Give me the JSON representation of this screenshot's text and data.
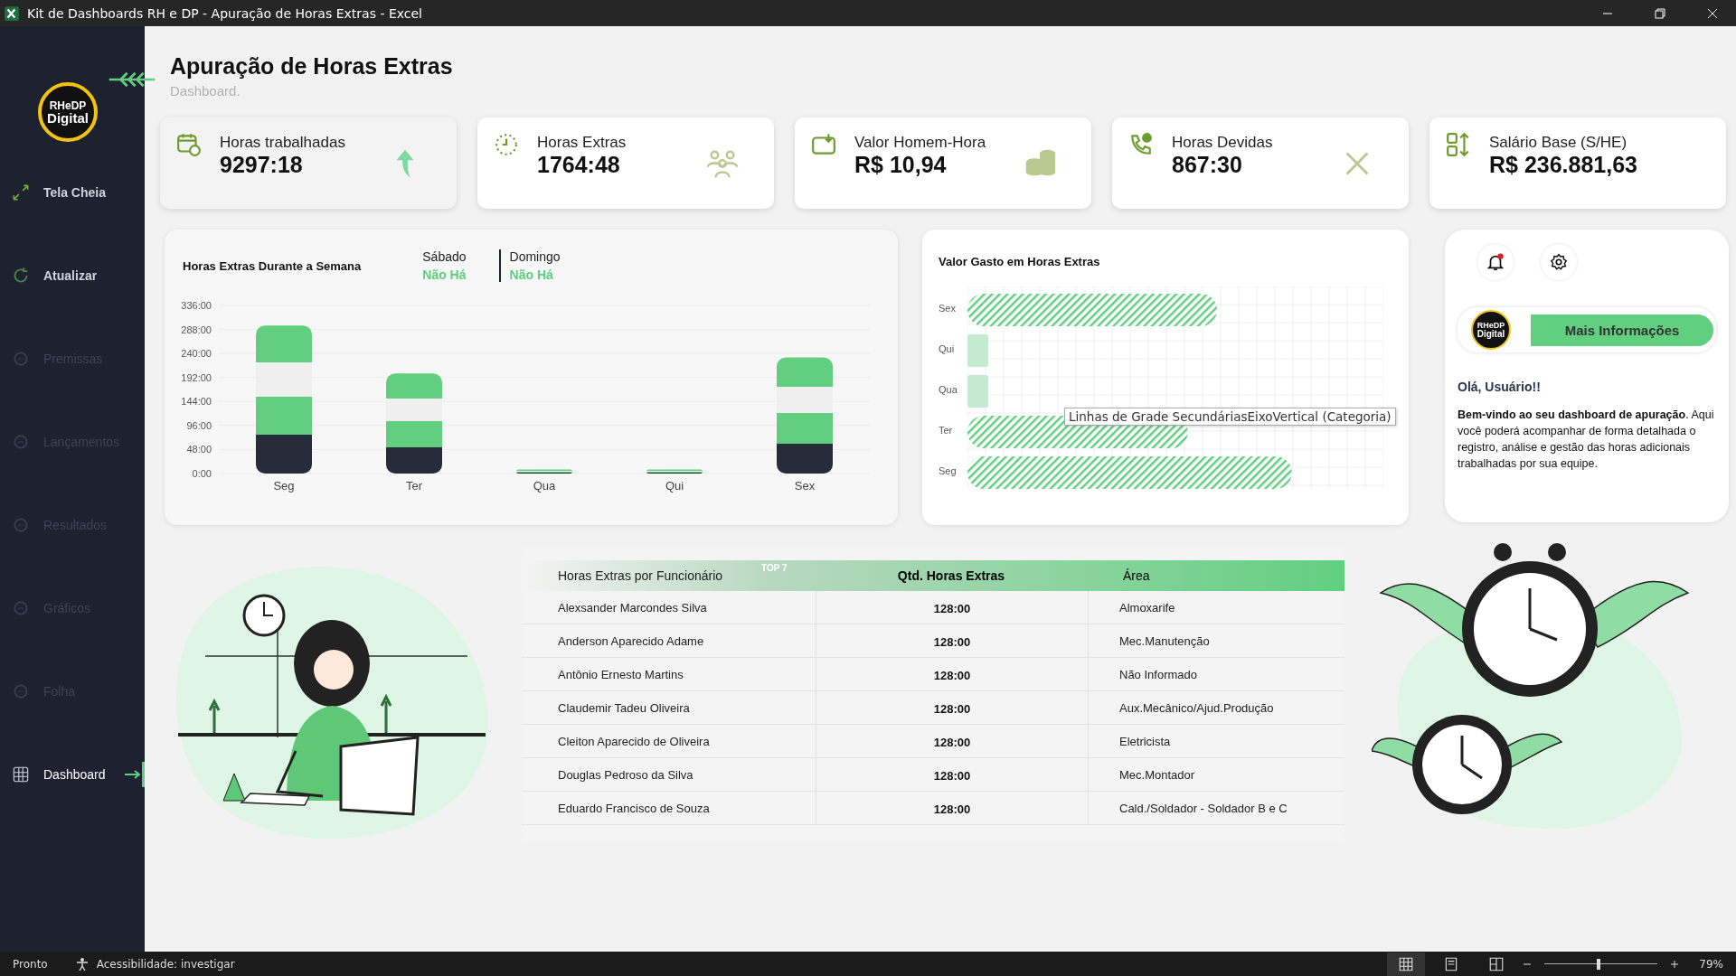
{
  "window": {
    "title": "Kit de Dashboards RH e DP - Apuração de Horas Extras - Excel"
  },
  "sidebar": {
    "logo": {
      "line1": "RHeDP",
      "line2": "Digital"
    },
    "items": [
      {
        "label": "Tela Cheia",
        "enabled": true,
        "selected": false
      },
      {
        "label": "Atualizar",
        "enabled": true,
        "selected": false
      },
      {
        "label": "Premissas",
        "enabled": false,
        "selected": false
      },
      {
        "label": "Lançamentos",
        "enabled": false,
        "selected": false
      },
      {
        "label": "Resultados",
        "enabled": false,
        "selected": false
      },
      {
        "label": "Gráficos",
        "enabled": false,
        "selected": false
      },
      {
        "label": "Folha",
        "enabled": false,
        "selected": false
      },
      {
        "label": "Dashboard",
        "enabled": true,
        "selected": true
      }
    ]
  },
  "header": {
    "title": "Apuração de Horas Extras",
    "subtitle": "Dashboard."
  },
  "kpis": [
    {
      "label": "Horas trabalhadas",
      "value": "9297:18",
      "highlighted": true
    },
    {
      "label": "Horas Extras",
      "value": "1764:48",
      "highlighted": false
    },
    {
      "label": "Valor Homem-Hora",
      "value": "R$ 10,94",
      "highlighted": false
    },
    {
      "label": "Horas Devidas",
      "value": "867:30",
      "highlighted": false
    },
    {
      "label": "Salário Base (S/HE)",
      "value": "R$ 236.881,63",
      "highlighted": false
    }
  ],
  "week_chart": {
    "title": "Horas Extras Durante a Semana",
    "weekend": [
      {
        "day": "Sábado",
        "value": "Não Há"
      },
      {
        "day": "Domingo",
        "value": "Não Há"
      }
    ],
    "chart_data": {
      "type": "bar",
      "categories": [
        "Seg",
        "Ter",
        "Qua",
        "Qui",
        "Sex"
      ],
      "values": [
        296,
        200,
        8,
        8,
        232
      ],
      "ylim": [
        0,
        336
      ],
      "grid": true,
      "yticks": [
        {
          "value": 0,
          "label": "0:00"
        },
        {
          "value": 48,
          "label": "48:00"
        },
        {
          "value": 96,
          "label": "96:00"
        },
        {
          "value": 144,
          "label": "144:00"
        },
        {
          "value": 192,
          "label": "192:00"
        },
        {
          "value": 240,
          "label": "240:00"
        },
        {
          "value": 288,
          "label": "288:00"
        },
        {
          "value": 336,
          "label": "336:00"
        }
      ]
    }
  },
  "cost_chart": {
    "title": "Valor Gasto em Horas Extras",
    "categories": [
      "Sex",
      "Qui",
      "Qua",
      "Ter",
      "Seg"
    ]
  },
  "tooltip": {
    "text": "Linhas de Grade SecundáriasEixoVertical (Categoria)"
  },
  "info_panel": {
    "has_notification": true,
    "logo": {
      "line1": "RHeDP",
      "line2": "Digital"
    },
    "button": "Mais Informações",
    "greeting": "Olá, Usuário!!",
    "intro": "Bem-vindo ao seu dashboard de apuração",
    "body": ". Aqui você poderá acompanhar de forma detalhada o registro, análise e gestão das horas adicionais trabalhadas por sua equipe."
  },
  "table": {
    "title": "Horas Extras por Funcionário",
    "badge": "TOP 7",
    "columns": [
      "Qtd. Horas Extras",
      "Área"
    ],
    "rows": [
      {
        "name": "Alexsander Marcondes Silva",
        "hours": "128:00",
        "area": "Almoxarife"
      },
      {
        "name": "Anderson Aparecido Adame",
        "hours": "128:00",
        "area": "Mec.Manutenção"
      },
      {
        "name": "Antônio Ernesto Martins",
        "hours": "128:00",
        "area": "Não Informado"
      },
      {
        "name": "Claudemir Tadeu Oliveira",
        "hours": "128:00",
        "area": "Aux.Mecânico/Ajud.Produção"
      },
      {
        "name": "Cleiton Aparecido de Oliveira",
        "hours": "128:00",
        "area": "Eletricista"
      },
      {
        "name": "Douglas Pedroso da Silva",
        "hours": "128:00",
        "area": "Mec.Montador"
      },
      {
        "name": "Eduardo Francisco de Souza",
        "hours": "128:00",
        "area": "Cald./Soldador - Soldador B e C"
      }
    ]
  },
  "status_bar": {
    "status": "Pronto",
    "accessibility": "Acessibilidade: investigar",
    "views": [
      {
        "selected": true
      },
      {
        "selected": false
      },
      {
        "selected": false
      }
    ],
    "zoom": {
      "level": 0.48
    },
    "zoom_label": "79%"
  }
}
